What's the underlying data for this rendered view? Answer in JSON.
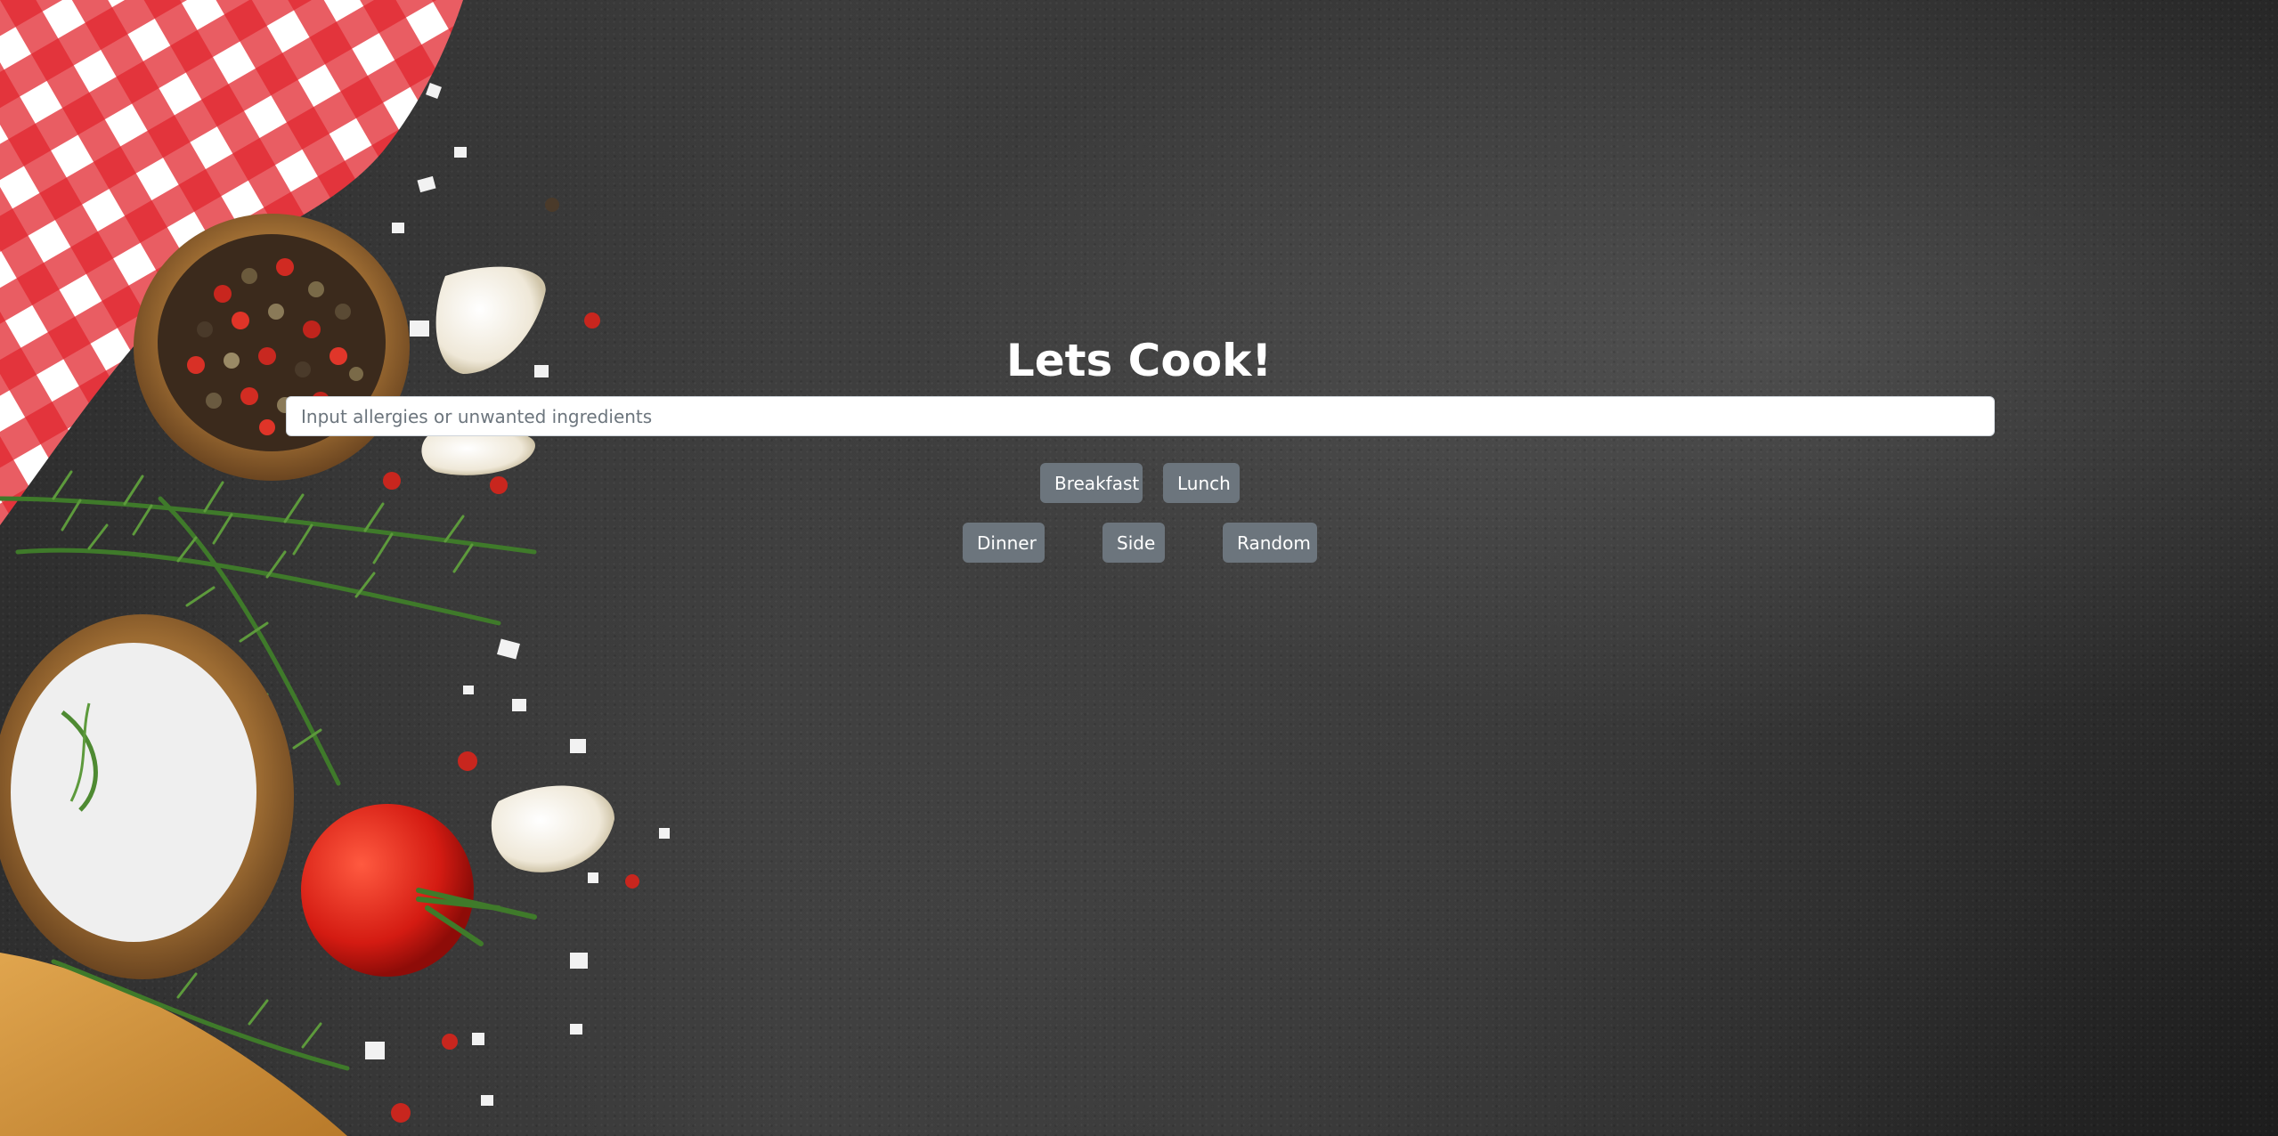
{
  "page": {
    "title": "Lets Cook!"
  },
  "search": {
    "placeholder": "Input allergies or unwanted ingredients",
    "value": ""
  },
  "meal_buttons": {
    "breakfast": "Breakfast",
    "lunch": "Lunch",
    "dinner": "Dinner",
    "side": "Side",
    "random": "Random"
  },
  "theme": {
    "button_color": "#6c757d",
    "title_color": "#ffffff",
    "background_color": "#2e2e2e"
  }
}
